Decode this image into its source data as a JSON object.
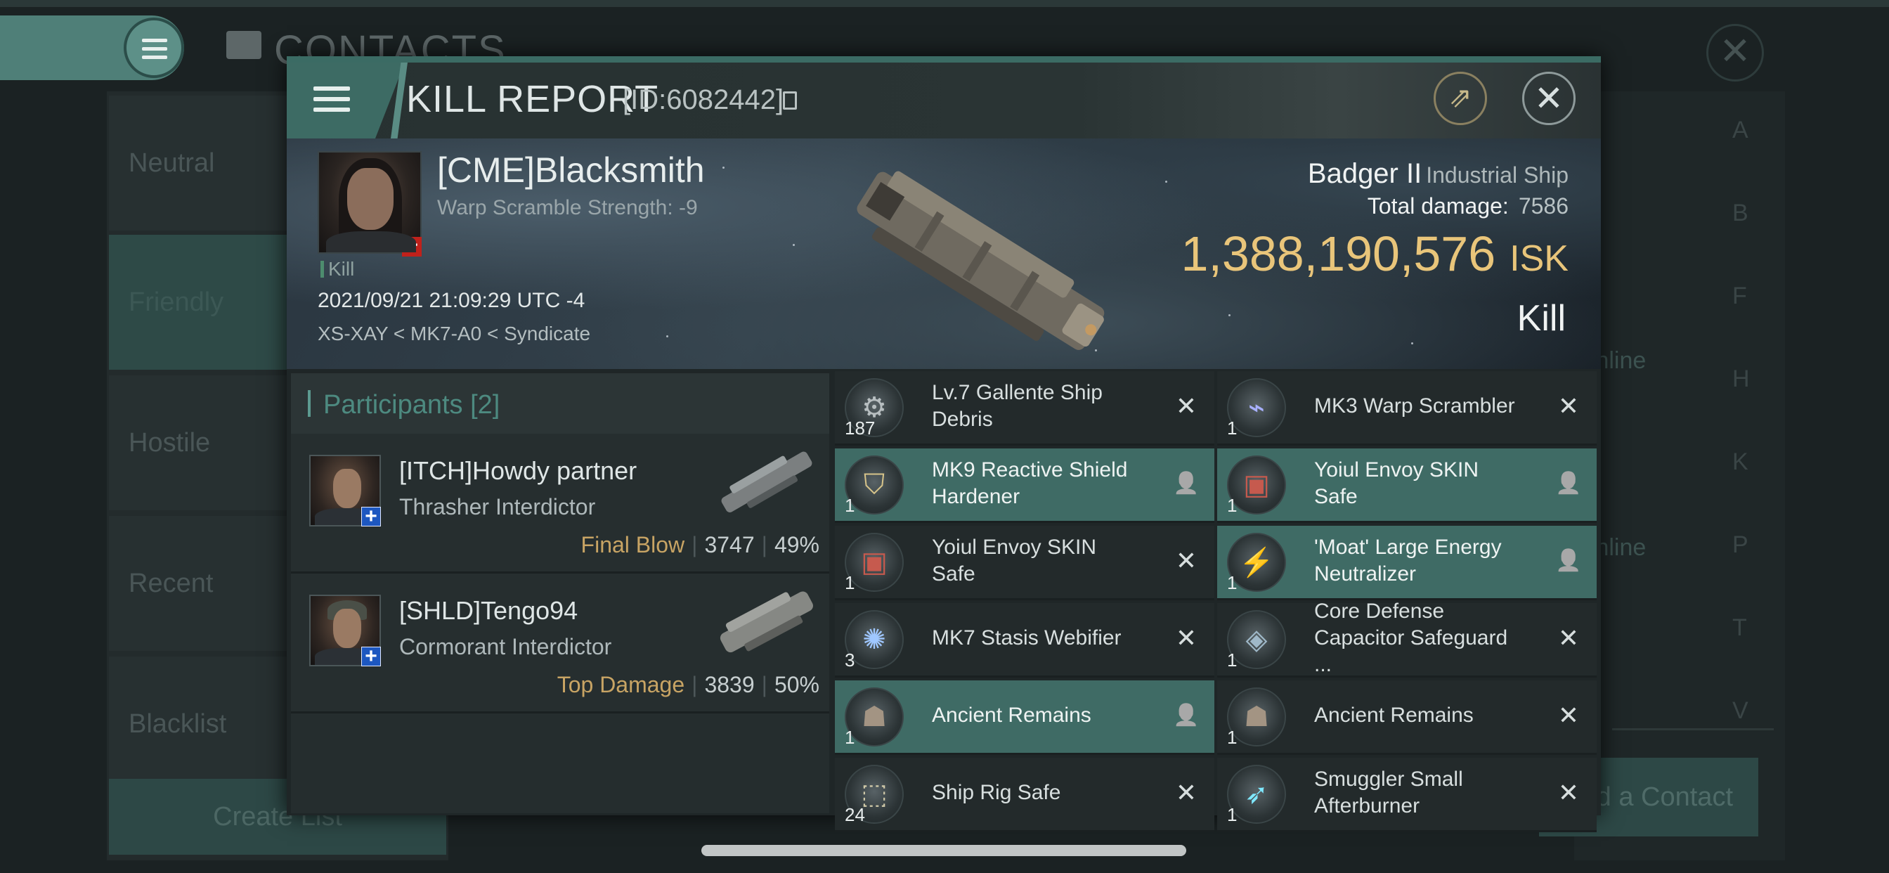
{
  "background": {
    "title": "CONTACTS",
    "sidebar": [
      "Neutral",
      "Friendly",
      "Hostile",
      "Recent",
      "Blacklist"
    ],
    "create_list": "Create List",
    "online_labels": [
      "Online",
      "Online"
    ],
    "add_contact": "d a Contact",
    "letters": [
      "A",
      "B",
      "F",
      "H",
      "K",
      "P",
      "T",
      "V"
    ]
  },
  "report": {
    "title": "KILL REPORT",
    "id": "[ID:6082442]",
    "victim": {
      "name": "[CME]Blacksmith",
      "sub": "Warp Scramble Strength: -9",
      "tag": "Kill",
      "datetime": "2021/09/21 21:09:29 UTC -4",
      "location": "XS-XAY < MK7-A0 < Syndicate",
      "ship": "Badger II",
      "ship_class": "Industrial Ship",
      "total_damage_label": "Total damage:",
      "total_damage": "7586",
      "isk": "1,388,190,576",
      "isk_unit": "ISK",
      "result": "Kill"
    },
    "participants": {
      "label": "Participants",
      "count": "[2]",
      "rows": [
        {
          "name": "[ITCH]Howdy partner",
          "ship": "Thrasher Interdictor",
          "role": "Final Blow",
          "damage": "3747",
          "percent": "49%"
        },
        {
          "name": "[SHLD]Tengo94",
          "ship": "Cormorant Interdictor",
          "role": "Top Damage",
          "damage": "3839",
          "percent": "50%"
        }
      ]
    },
    "items": [
      {
        "name": "Lv.7 Gallente Ship Debris",
        "qty": "187",
        "status": "destroyed",
        "highlight": false,
        "icon": "debris-icon"
      },
      {
        "name": "MK3 Warp Scrambler",
        "qty": "1",
        "status": "destroyed",
        "highlight": false,
        "icon": "warp-scrambler-icon"
      },
      {
        "name": "MK9 Reactive Shield Hardener",
        "qty": "1",
        "status": "dropped",
        "highlight": true,
        "icon": "shield-hardener-icon"
      },
      {
        "name": "Yoiul Envoy SKIN Safe",
        "qty": "1",
        "status": "dropped",
        "highlight": true,
        "icon": "skin-safe-icon"
      },
      {
        "name": "Yoiul Envoy SKIN Safe",
        "qty": "1",
        "status": "destroyed",
        "highlight": false,
        "icon": "skin-safe-icon"
      },
      {
        "name": "'Moat' Large Energy Neutralizer",
        "qty": "1",
        "status": "dropped",
        "highlight": true,
        "icon": "energy-neutralizer-icon"
      },
      {
        "name": "MK7 Stasis Webifier",
        "qty": "3",
        "status": "destroyed",
        "highlight": false,
        "icon": "stasis-webifier-icon"
      },
      {
        "name": "Core Defense Capacitor Safeguard ...",
        "qty": "1",
        "status": "destroyed",
        "highlight": false,
        "icon": "capacitor-safeguard-icon"
      },
      {
        "name": "Ancient Remains",
        "qty": "1",
        "status": "dropped",
        "highlight": true,
        "icon": "remains-icon"
      },
      {
        "name": "Ancient Remains",
        "qty": "1",
        "status": "destroyed",
        "highlight": false,
        "icon": "remains-icon"
      },
      {
        "name": "Ship Rig Safe",
        "qty": "24",
        "status": "destroyed",
        "highlight": false,
        "icon": "rig-safe-icon"
      },
      {
        "name": "Smuggler Small Afterburner",
        "qty": "1",
        "status": "destroyed",
        "highlight": false,
        "icon": "afterburner-icon"
      }
    ]
  },
  "colors": {
    "accent": "#3f6b65",
    "isk": "#e9c57a",
    "final_blow": "#c8a464",
    "badge_red": "#c0211b",
    "badge_blue": "#1d57c0"
  }
}
